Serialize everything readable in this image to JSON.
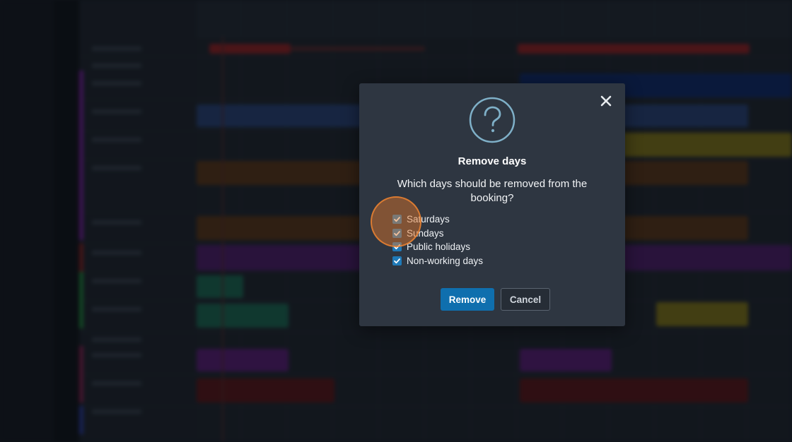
{
  "dialog": {
    "title": "Remove days",
    "question": "Which days should be removed from the booking?",
    "icon": "question-circle-icon",
    "close_icon": "close-icon",
    "options": [
      {
        "label": "Saturdays",
        "checked": true
      },
      {
        "label": "Sundays",
        "checked": true
      },
      {
        "label": "Public holidays",
        "checked": true
      },
      {
        "label": "Non-working days",
        "checked": true
      }
    ],
    "remove_label": "Remove",
    "cancel_label": "Cancel"
  },
  "colors": {
    "accent": "#0f6fae",
    "checkbox": "#1f7ab8",
    "dialog_bg": "#2e3641",
    "highlight": "#e67828"
  }
}
